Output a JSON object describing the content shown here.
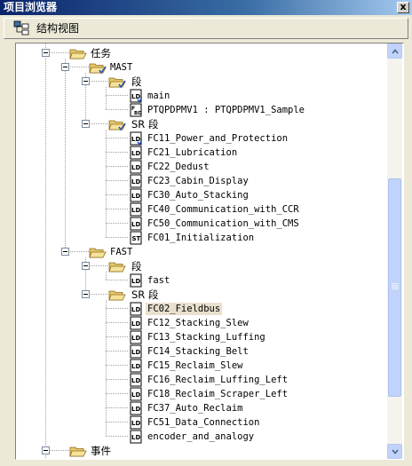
{
  "window": {
    "title": "项目浏览器",
    "close_label": "x"
  },
  "toolbar": {
    "view_label": "结构视图",
    "icon": "structure-view-icon"
  },
  "tree": {
    "tasks": {
      "label": "任务"
    },
    "mast": {
      "label": "MAST",
      "sections": {
        "label": "段",
        "items": [
          {
            "label": "main",
            "icon": "ld-icon",
            "check": true
          },
          {
            "label": "PTQPDPMV1 : PTQPDPMV1_Sample",
            "icon": "fbd-icon",
            "check": false
          }
        ]
      },
      "sr_sections": {
        "label": "SR 段",
        "items": [
          {
            "label": "FC11_Power_and_Protection",
            "icon": "ld-icon",
            "check": true
          },
          {
            "label": "FC21_Lubrication",
            "icon": "ld-icon",
            "check": false
          },
          {
            "label": "FC22_Dedust",
            "icon": "ld-icon",
            "check": false
          },
          {
            "label": "FC23_Cabin_Display",
            "icon": "ld-icon",
            "check": false
          },
          {
            "label": "FC30_Auto_Stacking",
            "icon": "ld-icon",
            "check": false
          },
          {
            "label": "FC40_Communication_with_CCR",
            "icon": "ld-icon",
            "check": false
          },
          {
            "label": "FC50_Communication_with_CMS",
            "icon": "ld-icon",
            "check": false
          },
          {
            "label": "FC01_Initialization",
            "icon": "st-icon",
            "check": false
          }
        ]
      }
    },
    "fast": {
      "label": "FAST",
      "sections": {
        "label": "段",
        "items": [
          {
            "label": "fast",
            "icon": "ld-icon",
            "check": false
          }
        ]
      },
      "sr_sections": {
        "label": "SR 段",
        "items": [
          {
            "label": "FC02_Fieldbus",
            "icon": "ld-icon",
            "check": false,
            "selected": true
          },
          {
            "label": "FC12_Stacking_Slew",
            "icon": "ld-icon",
            "check": false
          },
          {
            "label": "FC13_Stacking_Luffing",
            "icon": "ld-icon",
            "check": false
          },
          {
            "label": "FC14_Stacking_Belt",
            "icon": "ld-icon",
            "check": false
          },
          {
            "label": "FC15_Reclaim_Slew",
            "icon": "ld-icon",
            "check": false
          },
          {
            "label": "FC16_Reclaim_Luffing_Left",
            "icon": "ld-icon",
            "check": false
          },
          {
            "label": "FC18_Reclaim_Scraper_Left",
            "icon": "ld-icon",
            "check": false
          },
          {
            "label": "FC37_Auto_Reclaim",
            "icon": "ld-icon",
            "check": false
          },
          {
            "label": "FC51_Data_Connection",
            "icon": "ld-icon",
            "check": false
          },
          {
            "label": "encoder_and_analogy",
            "icon": "ld-icon",
            "check": false
          }
        ]
      }
    },
    "events": {
      "label": "事件"
    }
  },
  "colors": {
    "titlebar": "#0a246a",
    "scrollbar": "#c1d3fb",
    "selection": "#e9e0cf",
    "folder": "#f0d68a"
  }
}
